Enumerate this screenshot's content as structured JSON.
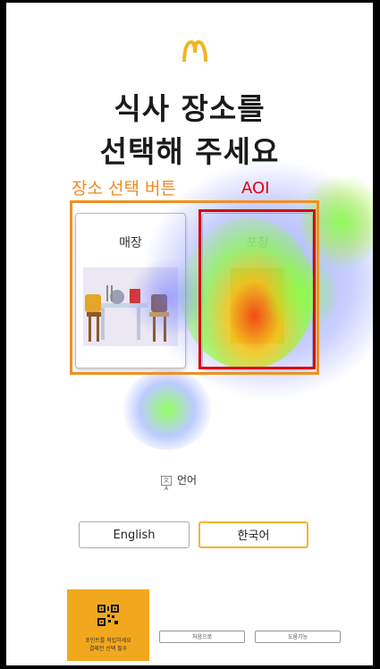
{
  "title": {
    "line1": "식사 장소를",
    "line2": "선택해 주세요"
  },
  "annotations": {
    "place_button_label": "장소 선택 버튼",
    "aoi_label": "AOI"
  },
  "options": {
    "dine_in": "매장",
    "takeout": "포장"
  },
  "language": {
    "label": "언어",
    "globe_text": "文A",
    "english": "English",
    "korean": "한국어"
  },
  "points": {
    "line1": "포인트를 적립하세요",
    "line2": "결제전 선택 필수"
  },
  "footer": {
    "home": "처음으로",
    "help": "도움기능"
  },
  "colors": {
    "brand_yellow": "#f2b51f",
    "annotation_orange": "#f08a24",
    "aoi_red": "#d8000f",
    "qr_panel": "#f2a81e"
  }
}
